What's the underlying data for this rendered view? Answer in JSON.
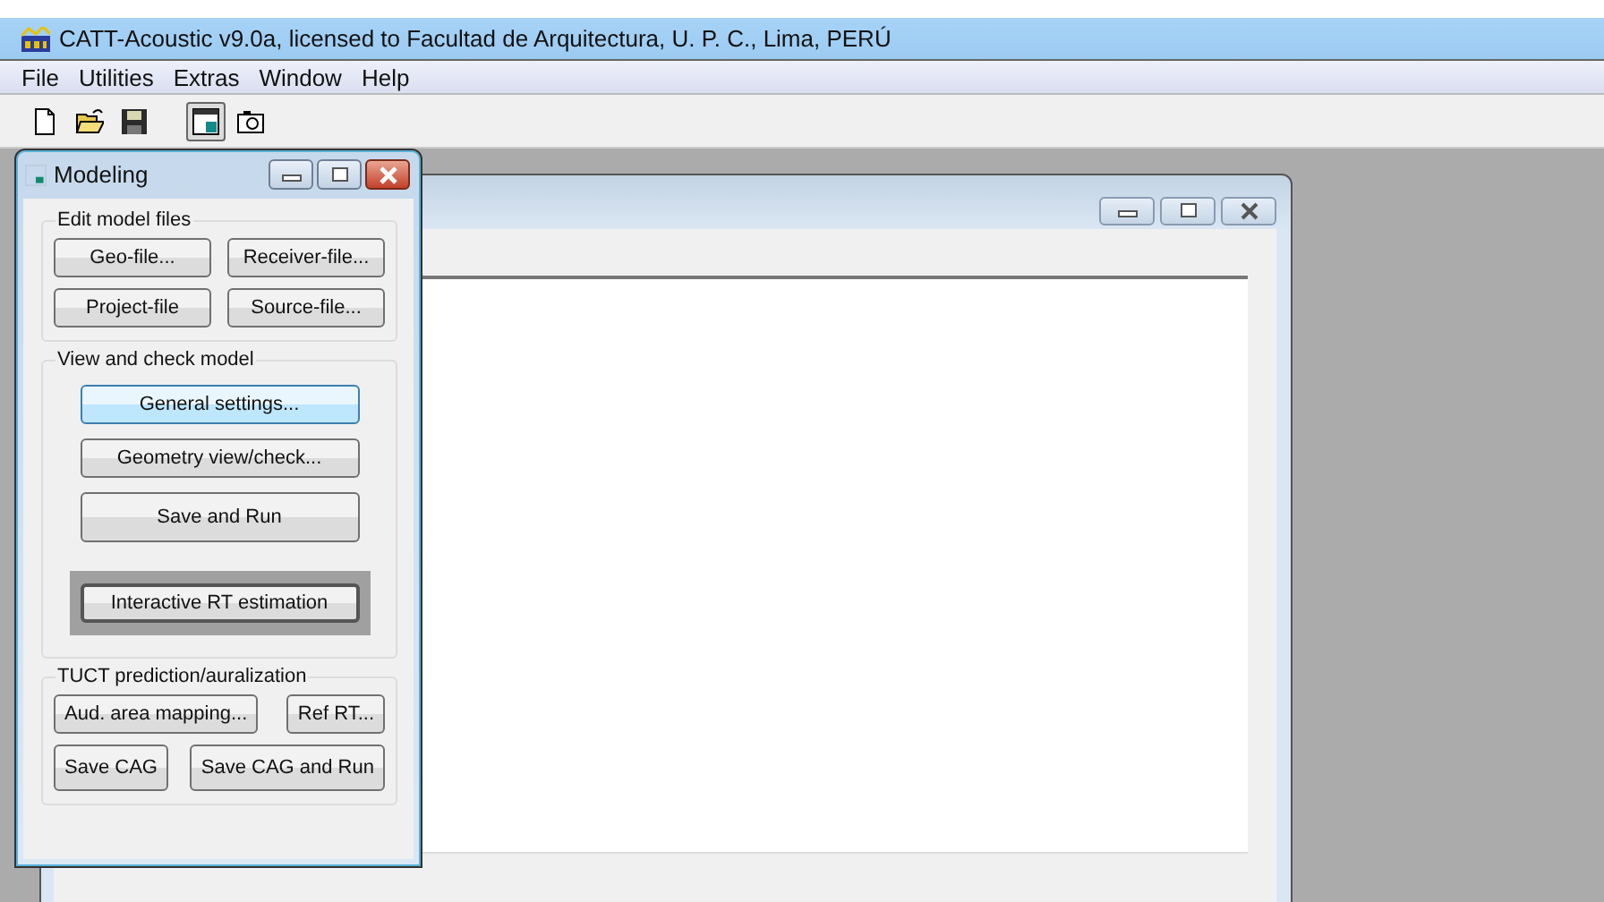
{
  "app_title": "CATT-Acoustic v9.0a, licensed to Facultad de Arquitectura, U. P. C., Lima, PERÚ",
  "menu": [
    "File",
    "Utilities",
    "Extras",
    "Window",
    "Help"
  ],
  "toolbar": [
    {
      "kind": "new",
      "pressed": false
    },
    {
      "kind": "open",
      "pressed": false
    },
    {
      "kind": "save",
      "pressed": false
    },
    {
      "kind": "modeling",
      "pressed": true
    },
    {
      "kind": "camera",
      "pressed": false
    }
  ],
  "modeling": {
    "title": "Modeling",
    "groups": [
      {
        "label": "Edit model files",
        "kind": "grid",
        "rows": [
          [
            {
              "label": "Geo-file...",
              "highlighted": false,
              "framed": false
            },
            {
              "label": "Receiver-file...",
              "highlighted": false,
              "framed": false
            }
          ],
          [
            {
              "label": "Project-file",
              "highlighted": false,
              "framed": false
            },
            {
              "label": "Source-file...",
              "highlighted": false,
              "framed": false
            }
          ]
        ]
      },
      {
        "label": "View and check model",
        "kind": "stack",
        "rows": [
          [
            {
              "label": "General settings...",
              "highlighted": true,
              "framed": false
            }
          ],
          [
            {
              "label": "Geometry view/check...",
              "highlighted": false,
              "framed": false
            }
          ],
          [
            {
              "label": "Save and Run",
              "highlighted": false,
              "framed": false
            }
          ],
          [
            {
              "label": "Interactive RT estimation",
              "highlighted": false,
              "framed": true
            }
          ]
        ]
      },
      {
        "label": "TUCT prediction/auralization",
        "kind": "flow",
        "rows": [
          [
            {
              "label": "Aud. area mapping...",
              "highlighted": false,
              "framed": false
            },
            {
              "label": "Ref RT...",
              "highlighted": false,
              "framed": false
            }
          ],
          [
            {
              "label": "Save CAG",
              "highlighted": false,
              "framed": false
            },
            {
              "label": "Save CAG and Run",
              "highlighted": false,
              "framed": false
            }
          ]
        ]
      }
    ]
  }
}
